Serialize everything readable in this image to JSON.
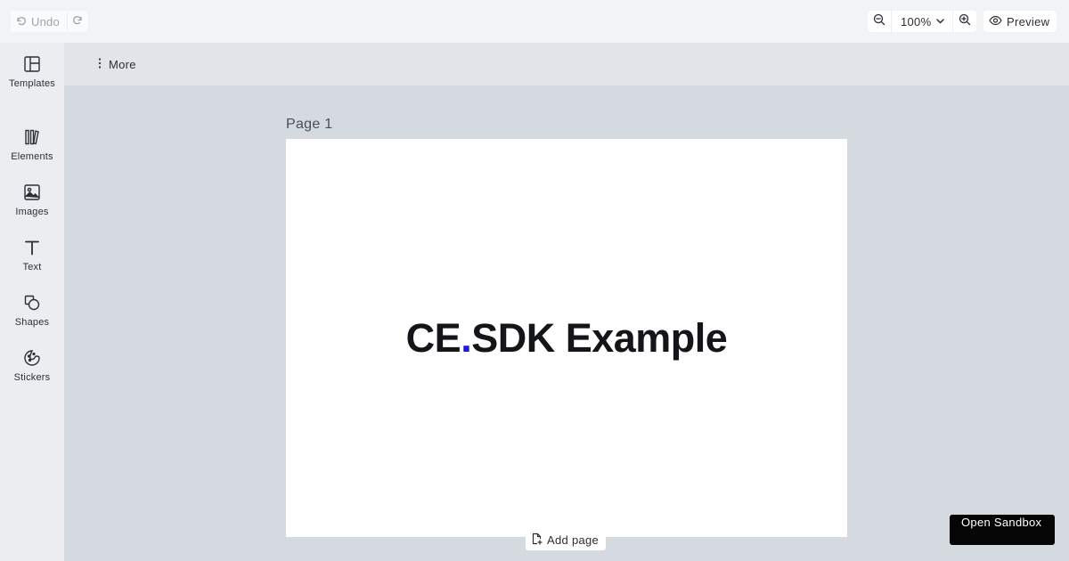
{
  "toolbar": {
    "undo_label": "Undo",
    "zoom_value": "100%",
    "preview_label": "Preview"
  },
  "sidebar": {
    "items": [
      {
        "label": "Templates",
        "icon": "templates-icon"
      },
      {
        "label": "Elements",
        "icon": "elements-icon"
      },
      {
        "label": "Images",
        "icon": "image-icon"
      },
      {
        "label": "Text",
        "icon": "text-icon"
      },
      {
        "label": "Shapes",
        "icon": "shapes-icon"
      },
      {
        "label": "Stickers",
        "icon": "sticker-icon"
      }
    ]
  },
  "subbar": {
    "more_label": "More"
  },
  "canvas": {
    "page_label": "Page 1",
    "text_before_dot": "CE",
    "text_dot": ".",
    "text_after_dot": "SDK Example",
    "dot_color": "#1a1adc",
    "add_page_label": "Add page"
  },
  "sandbox": {
    "label": "Open Sandbox"
  }
}
